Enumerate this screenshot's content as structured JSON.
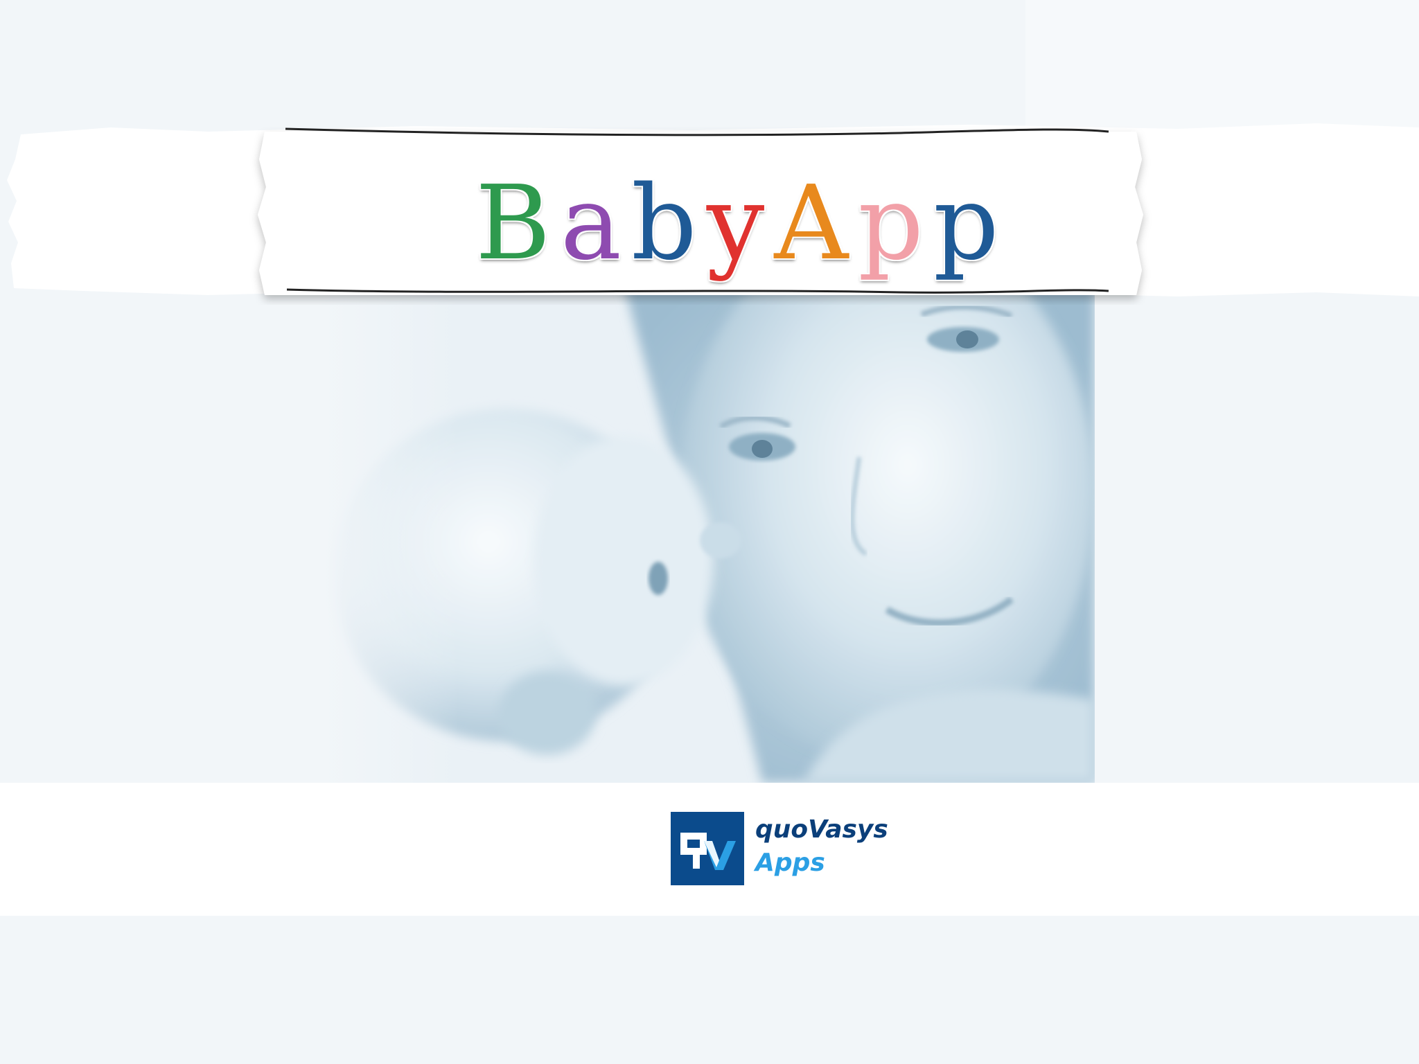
{
  "splash": {
    "title_letters": [
      {
        "char": "B",
        "color": "#2e9a4e"
      },
      {
        "char": "a",
        "color": "#8e4bb0"
      },
      {
        "char": "b",
        "color": "#1f5a96"
      },
      {
        "char": "y",
        "color": "#e0322f"
      },
      {
        "char": "A",
        "color": "#e8891d"
      },
      {
        "char": "p",
        "color": "#f2a0a8"
      },
      {
        "char": "p",
        "color": "#1f5a96"
      }
    ],
    "photo": "mother-and-baby-image",
    "background_color": "#f2f6f9"
  },
  "logo": {
    "badge": "QV",
    "name": "quoVasys",
    "sub": "Apps",
    "brand_color": "#0b4b8c",
    "accent_color": "#2b9fe4"
  }
}
